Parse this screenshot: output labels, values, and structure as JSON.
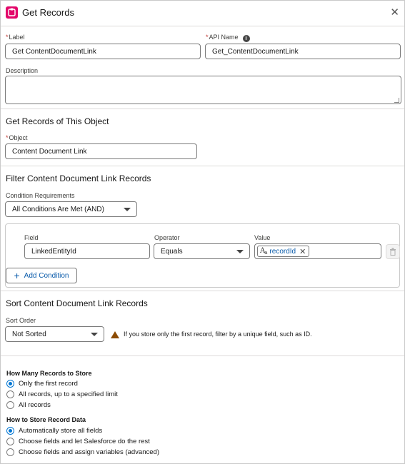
{
  "header": {
    "title": "Get Records",
    "close_icon": "close-icon",
    "app_icon": "get-records-icon",
    "app_icon_color": "#e3066a"
  },
  "fields": {
    "label": {
      "label": "Label",
      "value": "Get ContentDocumentLink"
    },
    "api_name": {
      "label": "API Name",
      "value": "Get_ContentDocumentLink",
      "info_icon": "info-icon"
    },
    "description": {
      "label": "Description",
      "value": ""
    }
  },
  "object_section": {
    "title": "Get Records of This Object",
    "object_label": "Object",
    "object_value": "Content Document Link"
  },
  "filter_section": {
    "title": "Filter Content Document Link Records",
    "condition_label": "Condition Requirements",
    "condition_value": "All Conditions Are Met (AND)",
    "columns": {
      "field": "Field",
      "operator": "Operator",
      "value": "Value"
    },
    "condition": {
      "field": "LinkedEntityId",
      "operator": "Equals",
      "value_pill": "recordId"
    },
    "add_condition": "Add Condition"
  },
  "sort_section": {
    "title": "Sort Content Document Link Records",
    "sort_label": "Sort Order",
    "sort_value": "Not Sorted",
    "warning": "If you store only the first record, filter by a unique field, such as ID."
  },
  "store_section": {
    "how_many_title": "How Many Records to Store",
    "how_many_options": [
      "Only the first record",
      "All records, up to a specified limit",
      "All records"
    ],
    "how_many_selected": 0,
    "how_store_title": "How to Store Record Data",
    "how_store_options": [
      "Automatically store all fields",
      "Choose fields and let Salesforce do the rest",
      "Choose fields and assign variables (advanced)"
    ],
    "how_store_selected": 0
  },
  "colors": {
    "brand_blue": "#0176d3",
    "link_blue": "#0b5cab",
    "required_red": "#c23934",
    "warning": "#8c4b02"
  }
}
